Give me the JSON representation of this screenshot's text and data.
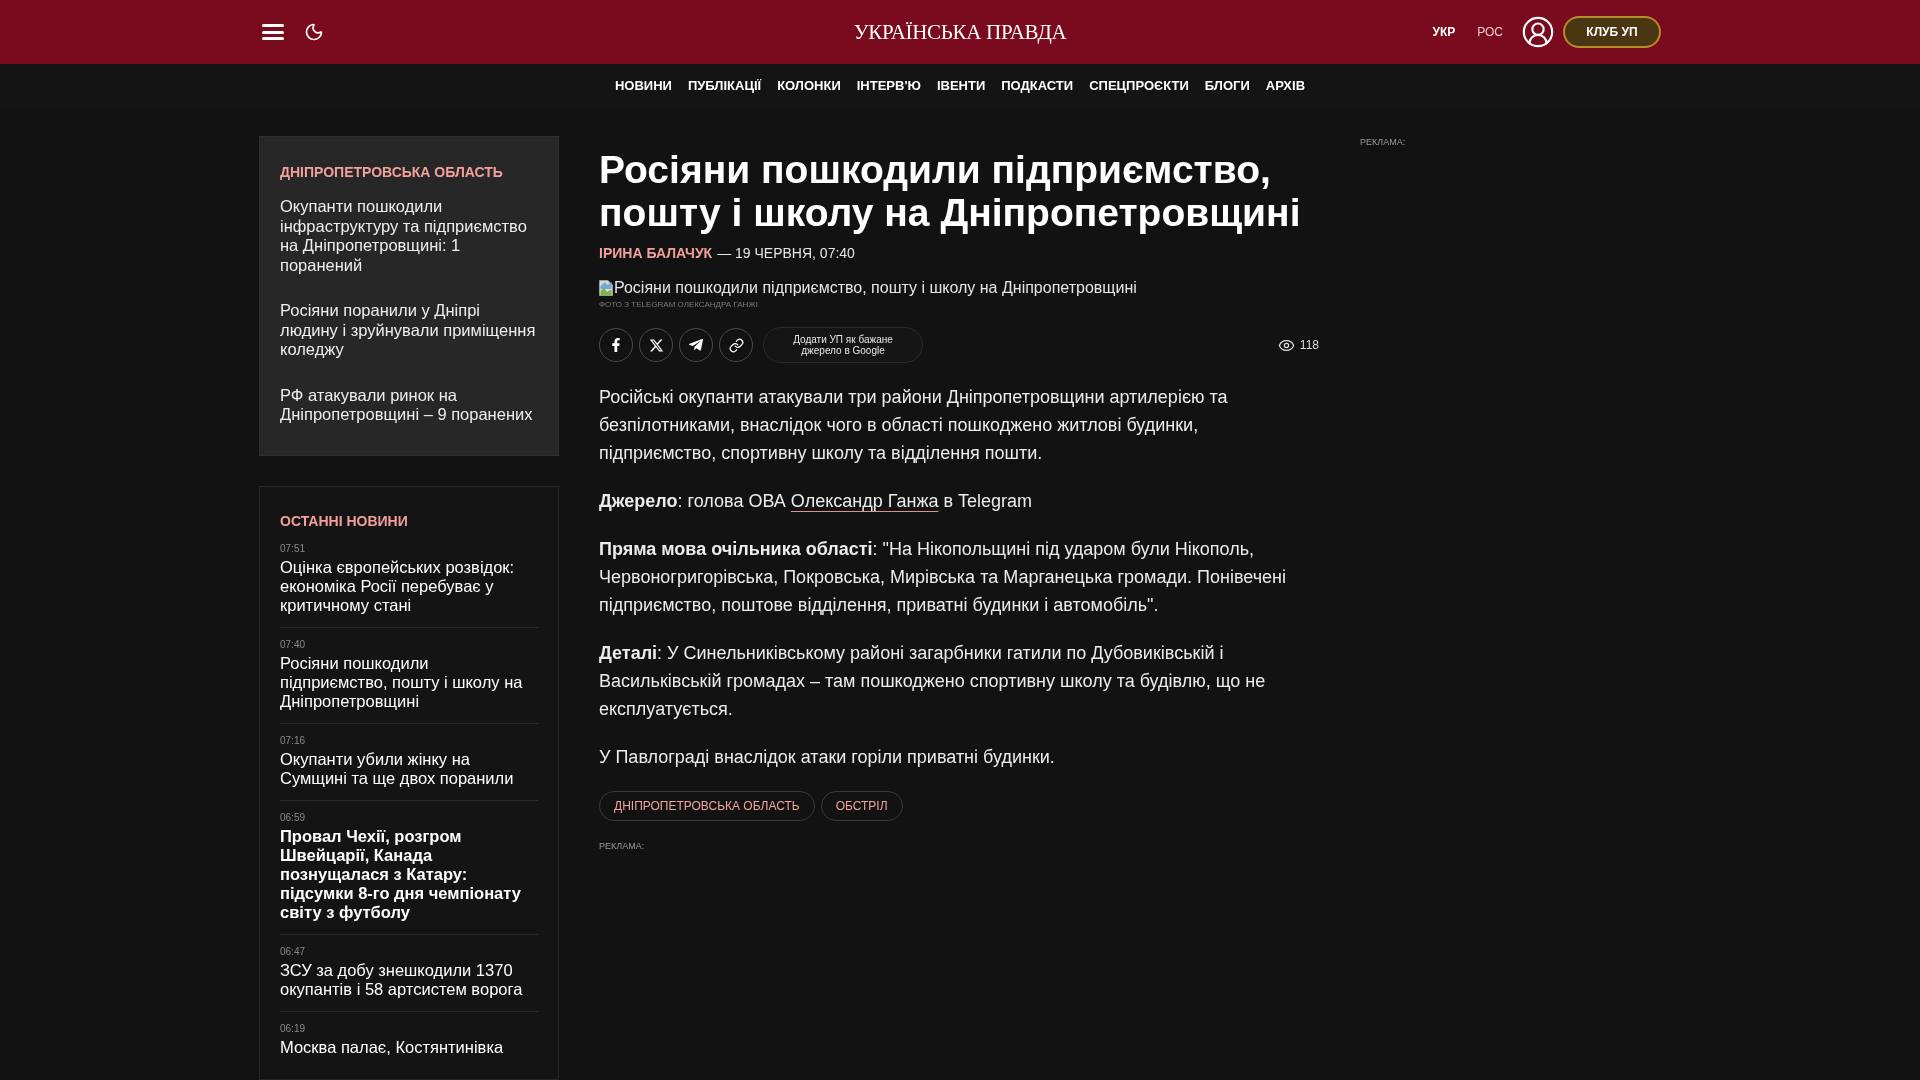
{
  "header": {
    "logo": "УКРАЇНСЬКА ПРАВДА",
    "languages": [
      {
        "label": "УКР",
        "selected": true
      },
      {
        "label": "РОС",
        "selected": false
      }
    ],
    "club_button": "КЛУБ УП"
  },
  "nav": [
    "НОВИНИ",
    "ПУБЛІКАЦІЇ",
    "КОЛОНКИ",
    "ІНТЕРВ'Ю",
    "ІВЕНТИ",
    "ПОДКАСТИ",
    "СПЕЦПРОЄКТИ",
    "БЛОГИ",
    "АРХІВ"
  ],
  "region_news": {
    "title": "ДНІПРОПЕТРОВСЬКА ОБЛАСТЬ",
    "items": [
      "Окупанти пошкодили інфраструктуру та підприємство на Дніпропетровщині: 1 поранений",
      "Росіяни поранили у Дніпрі людину і зруйнували приміщення коледжу",
      "РФ атакували ринок на Дніпропетровщині – 9 поранених"
    ]
  },
  "latest_news": {
    "title": "ОСТАННІ НОВИНИ",
    "items": [
      {
        "time": "07:51",
        "title": "Оцінка європейських розвідок: економіка Росії перебуває у критичному стані",
        "highlighted": false
      },
      {
        "time": "07:40",
        "title": "Росіяни пошкодили підприємство, пошту і школу на Дніпропетровщині",
        "highlighted": false
      },
      {
        "time": "07:16",
        "title": "Окупанти убили жінку на Сумщині та ще двох поранили",
        "highlighted": false
      },
      {
        "time": "06:59",
        "title": "Провал Чехії, розгром Швейцарії, Канада познущалася з Катару: підсумки 8-го дня чемпіонату світу з футболу",
        "highlighted": true
      },
      {
        "time": "06:47",
        "title": "ЗСУ за добу знешкодили 1370 окупантів і 58 артсистем ворога",
        "highlighted": false
      },
      {
        "time": "06:19",
        "title": "Москва палає, Костянтинівка",
        "highlighted": false
      }
    ]
  },
  "article": {
    "title": "Росіяни пошкодили підприємство, пошту і школу на Дніпропетровщині",
    "author": "ІРИНА БАЛАЧУК",
    "dateline": "— 19 ЧЕРВНЯ, 07:40",
    "image_alt": "Росіяни пошкодили підприємство, пошту і школу на Дніпропетровщині",
    "photo_caption": "ФОТО З TELEGRAM ОЛЕКСАНДРА ГАНЖІ",
    "share_buttons": [
      {
        "kind": "facebook"
      },
      {
        "kind": "x"
      },
      {
        "kind": "telegram"
      },
      {
        "kind": "link"
      }
    ],
    "google_source_button": "Додати УП як бажане джерело в Google",
    "views": "118",
    "paragraphs": [
      {
        "segments": [
          {
            "kind": "text",
            "text": "Російські окупанти атакували три райони Дніпропетровщини артилерією та безпілотниками, внаслідок чого в області пошкоджено житлові будинки, підприємство, спортивну школу та відділення пошти."
          }
        ]
      },
      {
        "segments": [
          {
            "kind": "text",
            "text": "**Джерело**: голова ОВА "
          },
          {
            "kind": "link",
            "text": "Олександр Ганжа"
          },
          {
            "kind": "text",
            "text": " в Telegram"
          }
        ]
      },
      {
        "segments": [
          {
            "kind": "text",
            "text": "**Пряма мова очільника області**: \"На Нікопольщині під ударом були Нікополь, Червоногригорівська, Покровська, Мирівська та Марганецька громади. Понівечені підприємство, поштове відділення, приватні будинки і автомобіль\"."
          }
        ]
      },
      {
        "segments": [
          {
            "kind": "text",
            "text": "**Деталі**: У Синельниківському районі загарбники гатили по Дубовиківській і Васильківській громадах – там пошкоджено спортивну школу та будівлю, що не експлуатується."
          }
        ]
      },
      {
        "segments": [
          {
            "kind": "text",
            "text": "У Павлограді внаслідок атаки горіли приватні будинки."
          }
        ]
      }
    ],
    "tags": [
      "ДНІПРОПЕТРОВСЬКА ОБЛАСТЬ",
      "ОБСТРІЛ"
    ],
    "ad_label": "РЕКЛАМА:"
  },
  "side_ad": {
    "label": "РЕКЛАМА:"
  }
}
